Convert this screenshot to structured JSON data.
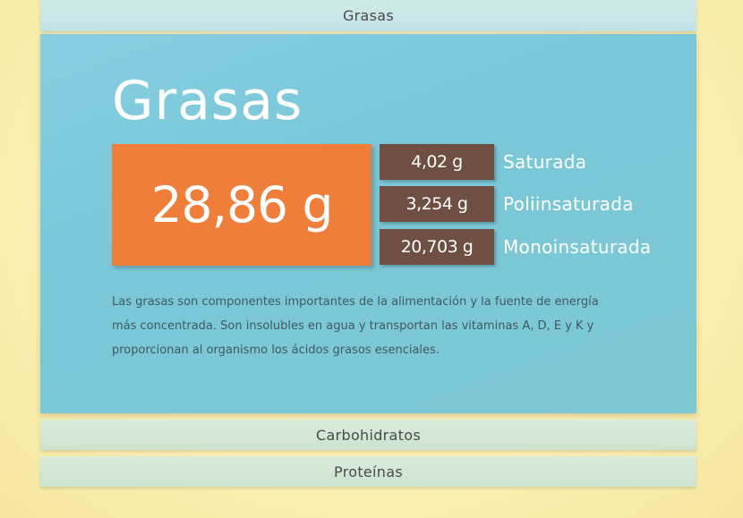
{
  "accordion": {
    "sections": [
      {
        "label": "Grasas"
      },
      {
        "label": "Carbohidratos"
      },
      {
        "label": "Proteínas"
      }
    ]
  },
  "panel": {
    "title": "Grasas",
    "total": "28,86 g",
    "breakdown": [
      {
        "value": "4,02 g",
        "label": "Saturada"
      },
      {
        "value": "3,254 g",
        "label": "Poliinsaturada"
      },
      {
        "value": "20,703 g",
        "label": "Monoinsaturada"
      }
    ],
    "description": "Las grasas son componentes importantes de la alimentación y la fuente de energía más concentrada. Son insolubles en agua y transportan las vitaminas A, D, E y K y proporcionan al organismo los ácidos grasos esenciales."
  },
  "colors": {
    "total_box": "#ee7e3a",
    "sub_box": "#6e4f42",
    "panel": "#7fc8da"
  }
}
